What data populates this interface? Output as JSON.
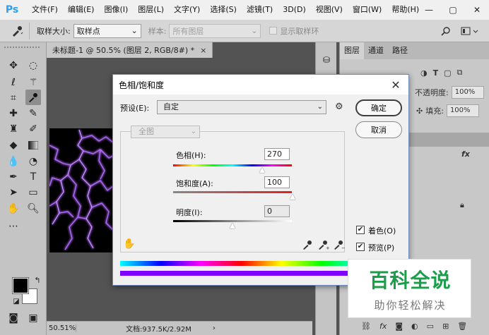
{
  "app": {
    "logo": "Ps"
  },
  "menu": {
    "items": [
      "文件(F)",
      "编辑(E)",
      "图像(I)",
      "图层(L)",
      "文字(Y)",
      "选择(S)",
      "滤镜(T)",
      "3D(D)",
      "视图(V)",
      "窗口(W)",
      "帮助(H)"
    ]
  },
  "window_controls": {
    "minimize": "—",
    "maximize": "▢",
    "close": "✕"
  },
  "options_bar": {
    "sample_size_label": "取样大小:",
    "sample_size_value": "取样点",
    "sample_label": "样本:",
    "sample_value": "所有图层",
    "show_ring_label": "显示取样环"
  },
  "document": {
    "tab_title": "未标题-1 @ 50.5% (图层 2, RGB/8#) *",
    "tab_close": "×",
    "zoom": "50.51%",
    "doc_info": "文档:937.5K/2.92M",
    "status_arrow": "›"
  },
  "right_panel": {
    "tabs": [
      "图层",
      "通道",
      "路径"
    ],
    "opacity_label": "不透明度:",
    "opacity_value": "100%",
    "fill_label": "填充:",
    "fill_value": "100%",
    "fx": "fx"
  },
  "dialog": {
    "title": "色相/饱和度",
    "close": "✕",
    "preset_label": "预设(E):",
    "preset_value": "自定",
    "ok_label": "确定",
    "cancel_label": "取消",
    "channel_value": "全图",
    "hue_label": "色相(H):",
    "hue_value": "270",
    "saturation_label": "饱和度(A):",
    "saturation_value": "100",
    "lightness_label": "明度(I):",
    "lightness_value": "0",
    "colorize_label": "着色(O)",
    "colorize_checked": true,
    "preview_label": "预览(P)",
    "preview_checked": true
  },
  "watermark": {
    "title": "百科全说",
    "subtitle": "助你轻松解决"
  },
  "colors": {
    "accent_green": "#1b9d4a",
    "ps_blue": "#2da0f0",
    "electric_purple": "#9b30ff"
  }
}
